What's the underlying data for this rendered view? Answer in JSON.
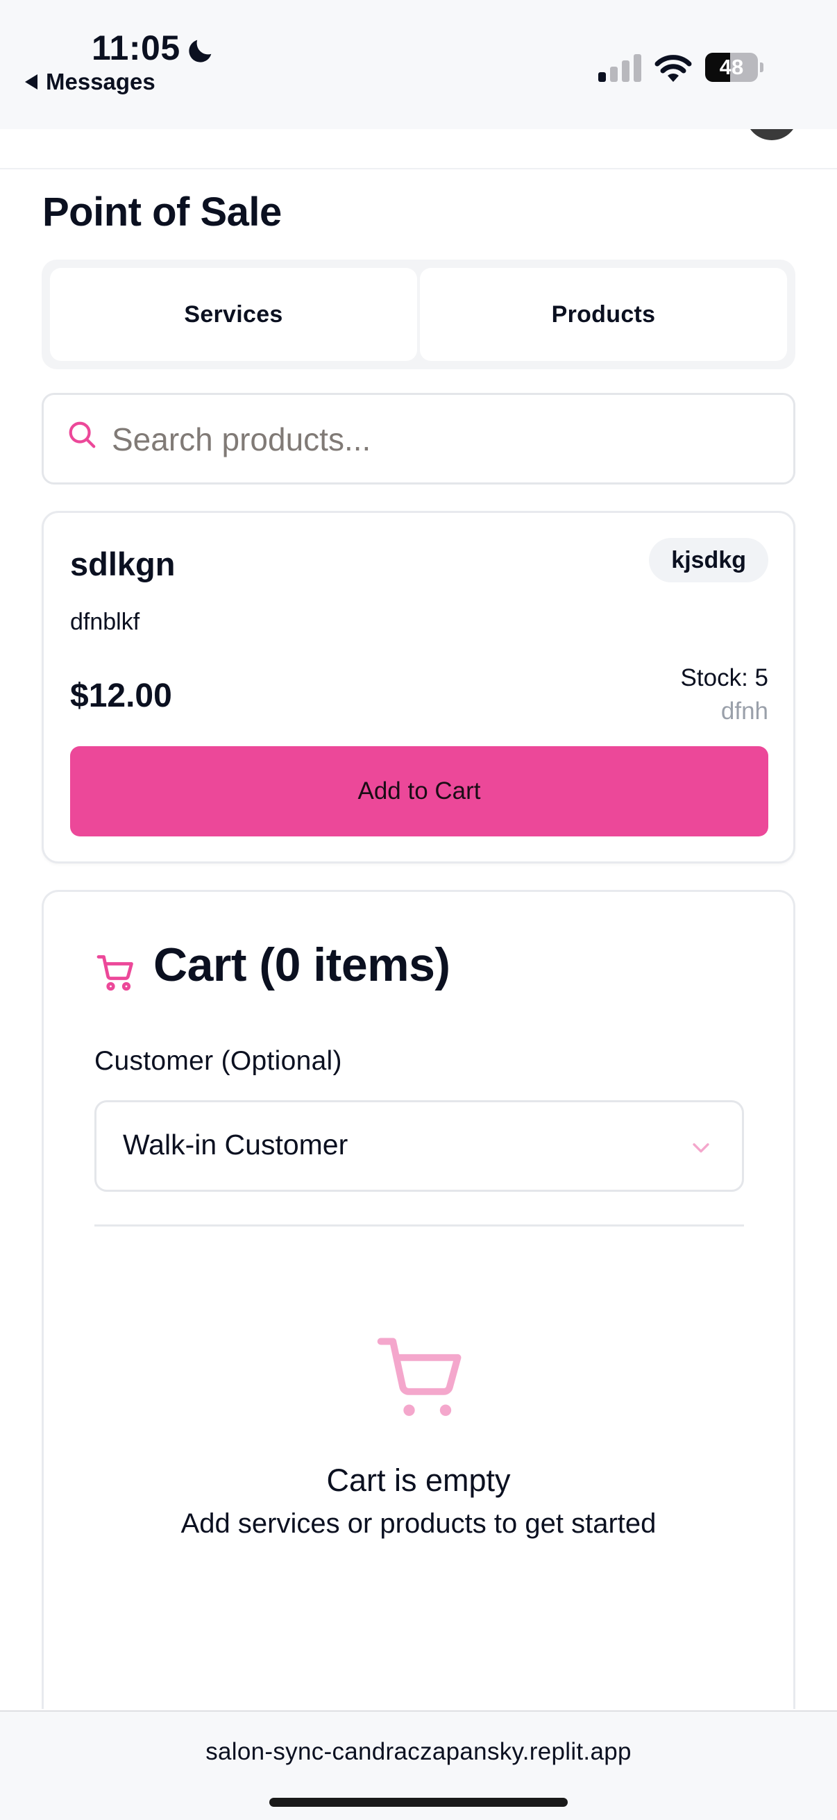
{
  "status_bar": {
    "time": "11:05",
    "back_label": "Messages",
    "battery_level": "48",
    "battery_fraction": 0.48
  },
  "page": {
    "title": "Point of Sale"
  },
  "tabs": [
    {
      "label": "Services"
    },
    {
      "label": "Products"
    }
  ],
  "search": {
    "placeholder": "Search products...",
    "value": ""
  },
  "product": {
    "name": "sdlkgn",
    "category": "kjsdkg",
    "description": "dfnblkf",
    "price": "$12.00",
    "stock": "Stock: 5",
    "sku": "dfnh",
    "add_button": "Add to Cart"
  },
  "cart": {
    "title": "Cart (0 items)",
    "customer_label": "Customer (Optional)",
    "customer_value": "Walk-in Customer",
    "empty_title": "Cart is empty",
    "empty_subtitle": "Add services or products to get started"
  },
  "browser": {
    "url": "salon-sync-candraczapansky.replit.app"
  },
  "colors": {
    "accent": "#ec4899",
    "accent_light": "#f4a7cc"
  },
  "icons": [
    "moon-icon",
    "signal-icon",
    "wifi-icon",
    "battery-icon",
    "search-icon",
    "cart-icon",
    "chevron-down-icon",
    "cart-empty-icon"
  ]
}
